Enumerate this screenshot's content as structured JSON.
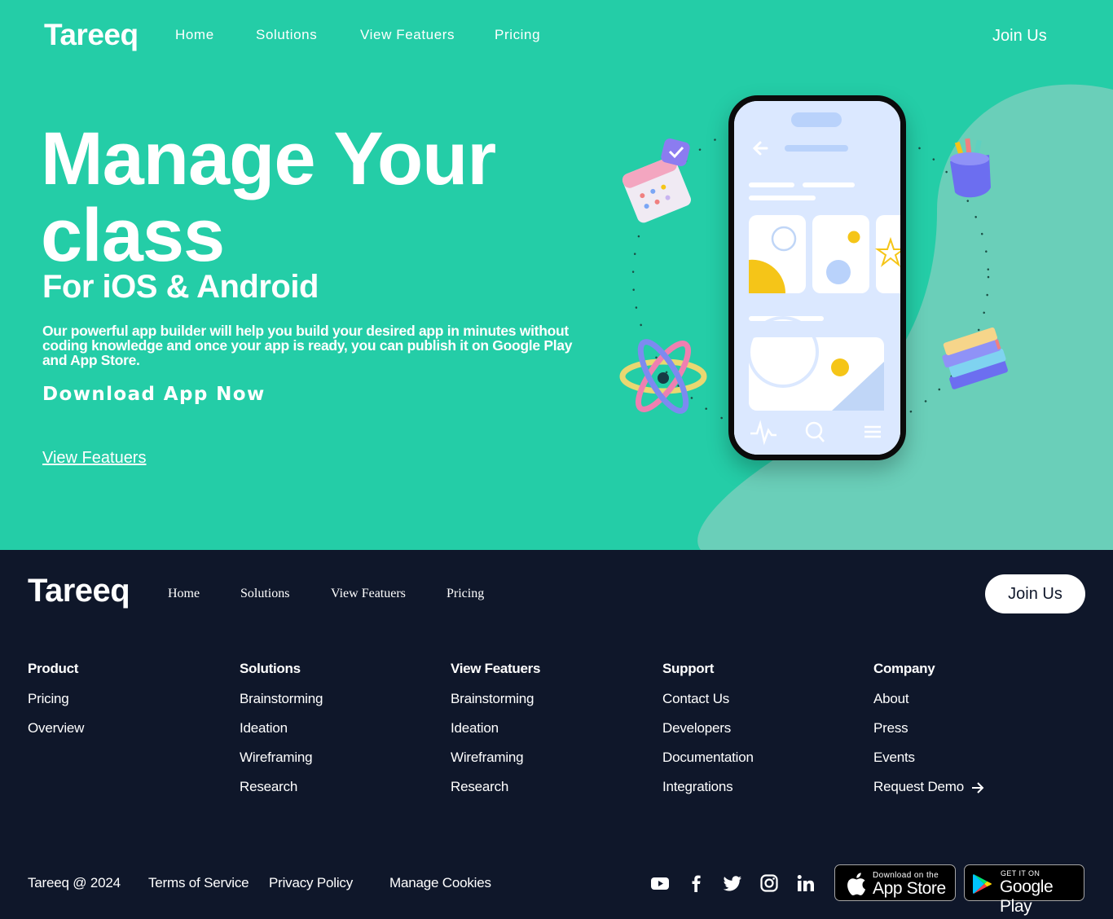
{
  "topnav": {
    "logo": "Tareeq",
    "links": [
      "Home",
      "Solutions",
      "View Featuers",
      "Pricing"
    ],
    "join": "Join Us"
  },
  "hero": {
    "title_line1": "Manage Your",
    "title_line2": "class",
    "subtitle": "For iOS & Android",
    "description": "Our powerful app builder will help you build your desired app in minutes without coding knowledge and once your app is ready, you can publish it on Google Play and App Store.",
    "cta": "Download App Now",
    "link": "View Featuers"
  },
  "footer": {
    "logo": "Tareeq",
    "nav": [
      "Home",
      "Solutions",
      "View Featuers",
      "Pricing"
    ],
    "join": "Join Us",
    "columns": [
      {
        "title": "Product",
        "items": [
          "Pricing",
          "Overview"
        ]
      },
      {
        "title": "Solutions",
        "items": [
          "Brainstorming",
          "Ideation",
          "Wireframing",
          "Research"
        ]
      },
      {
        "title": "View Featuers",
        "items": [
          "Brainstorming",
          "Ideation",
          "Wireframing",
          "Research"
        ]
      },
      {
        "title": "Support",
        "items": [
          "Contact Us",
          "Developers",
          "Documentation",
          "Integrations"
        ]
      },
      {
        "title": "Company",
        "items": [
          "About",
          "Press",
          "Events",
          "Request Demo"
        ]
      }
    ],
    "copyright": "Tareeq @ 2024",
    "legal": [
      "Terms of Service",
      "Privacy Policy",
      "Manage Cookies"
    ],
    "social_icons": [
      "youtube-icon",
      "facebook-icon",
      "twitter-icon",
      "instagram-icon",
      "linkedin-icon"
    ],
    "app_store": {
      "small": "Download on the",
      "big": "App Store"
    },
    "google_play": {
      "small": "GET IT ON",
      "big": "Google Play"
    }
  },
  "colors": {
    "hero_bg": "#24cda7",
    "footer_bg": "#0f172a",
    "phone_screen": "#dbe8ff",
    "accent_yellow": "#f5c518"
  }
}
